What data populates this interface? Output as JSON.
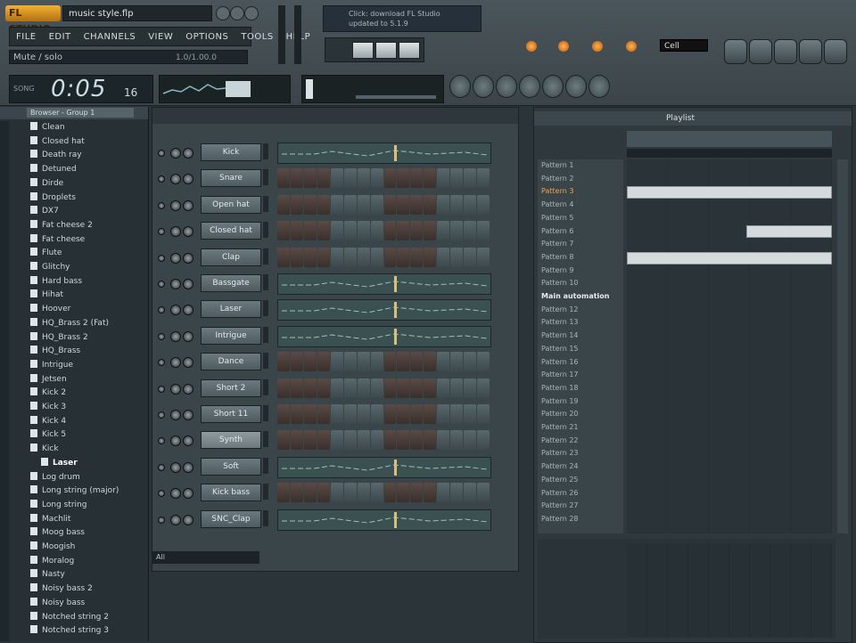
{
  "app": {
    "logo_text": "FL STUDIO",
    "filename": "music style.flp"
  },
  "menu": [
    "FILE",
    "EDIT",
    "CHANNELS",
    "VIEW",
    "OPTIONS",
    "TOOLS",
    "HELP"
  ],
  "hint": {
    "text": "Mute / solo",
    "value": "1.0/1.00.0"
  },
  "time": {
    "label": "SONG",
    "value": "0:05",
    "ms": "16"
  },
  "update_hint": {
    "line1": "Click: download FL Studio",
    "line2": "updated to 5.1.9"
  },
  "bpm": "Cell",
  "browser": {
    "title": "Browser - Group 1",
    "items": [
      "Clean",
      "Closed hat",
      "Death ray",
      "Detuned",
      "Dirde",
      "Droplets",
      "DX7",
      "Fat cheese 2",
      "Fat cheese",
      "Flute",
      "Glitchy",
      "Hard bass",
      "Hihat",
      "Hoover",
      "HQ_Brass 2 (Fat)",
      "HQ_Brass 2",
      "HQ_Brass",
      "Intrigue",
      "Jetsen",
      "Kick 2",
      "Kick 3",
      "Kick 4",
      "Kick 5",
      "Kick",
      "Laser",
      "Log drum",
      "Long string (major)",
      "Long string",
      "Machlit",
      "Moog bass",
      "Moogish",
      "Moralog",
      "Nasty",
      "Noisy bass 2",
      "Noisy bass",
      "Notched string 2",
      "Notched string 3"
    ],
    "selected": "Laser"
  },
  "channels": [
    {
      "name": "Kick"
    },
    {
      "name": "Snare"
    },
    {
      "name": "Open hat"
    },
    {
      "name": "Closed hat"
    },
    {
      "name": "Clap"
    },
    {
      "name": "Bassgate"
    },
    {
      "name": "Laser"
    },
    {
      "name": "Intrigue"
    },
    {
      "name": "Dance"
    },
    {
      "name": "Short 2"
    },
    {
      "name": "Short 11"
    },
    {
      "name": "Synth"
    },
    {
      "name": "Soft"
    },
    {
      "name": "Kick bass"
    },
    {
      "name": "SNC_Clap"
    }
  ],
  "rack_footer": "All",
  "playlist": {
    "title": "Playlist",
    "patterns": [
      "Pattern 1",
      "Pattern 2",
      "Pattern 3",
      "Pattern 4",
      "Pattern 5",
      "Pattern 6",
      "Pattern 7",
      "Pattern 8",
      "Pattern 9",
      "Pattern 10",
      "Main automation",
      "Pattern 12",
      "Pattern 13",
      "Pattern 14",
      "Pattern 15",
      "Pattern 16",
      "Pattern 17",
      "Pattern 18",
      "Pattern 19",
      "Pattern 20",
      "Pattern 21",
      "Pattern 22",
      "Pattern 23",
      "Pattern 24",
      "Pattern 25",
      "Pattern 26",
      "Pattern 27",
      "Pattern 28"
    ],
    "active": "Pattern 3",
    "automation": "Main automation"
  },
  "colors": {
    "accent_orange": "#f0a447",
    "background": "#2b3438"
  }
}
